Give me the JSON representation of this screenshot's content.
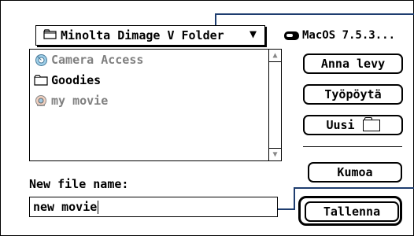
{
  "dialog": {
    "folder_popup": {
      "label": "Minolta Dimage V Folder",
      "arrow": "▼"
    },
    "disk": {
      "label": "MacOS 7.5.3..."
    },
    "files": [
      {
        "name": "Camera Access",
        "icon": "camera-app-icon",
        "enabled": false
      },
      {
        "name": "Goodies",
        "icon": "folder-icon",
        "enabled": true
      },
      {
        "name": "my movie",
        "icon": "movie-document-icon",
        "enabled": false
      }
    ],
    "buttons": {
      "eject": "Anna levy",
      "desktop": "Työpöytä",
      "new_folder": "Uusi",
      "cancel": "Kumoa",
      "save": "Tallenna"
    },
    "new_file_label": "New file name:",
    "new_file_value": "new movie",
    "colors": {
      "annotation_line": "#1e3d6f",
      "disabled_text": "#808080"
    }
  }
}
